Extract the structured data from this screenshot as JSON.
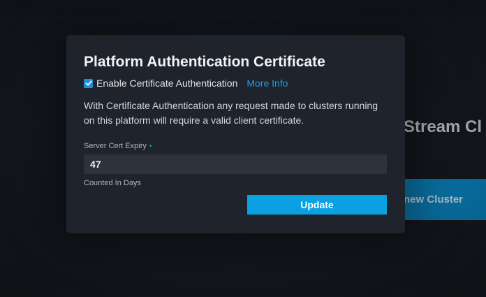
{
  "background": {
    "heading": "Stream Cl",
    "button_label": "new Cluster"
  },
  "modal": {
    "title": "Platform Authentication Certificate",
    "checkbox": {
      "label": "Enable Certificate Authentication",
      "checked": true
    },
    "more_info_link": "More Info",
    "description": "With Certificate Authentication any request made to clusters running on this platform will require a valid client certificate.",
    "expiry_field": {
      "label": "Server Cert Expiry",
      "required_marker": "•",
      "value": "47",
      "hint": "Counted In Days"
    },
    "update_button": "Update"
  },
  "colors": {
    "accent": "#0aa0e2",
    "link": "#1e9be0",
    "modal_bg": "#1f232b",
    "page_bg": "#171a21"
  }
}
